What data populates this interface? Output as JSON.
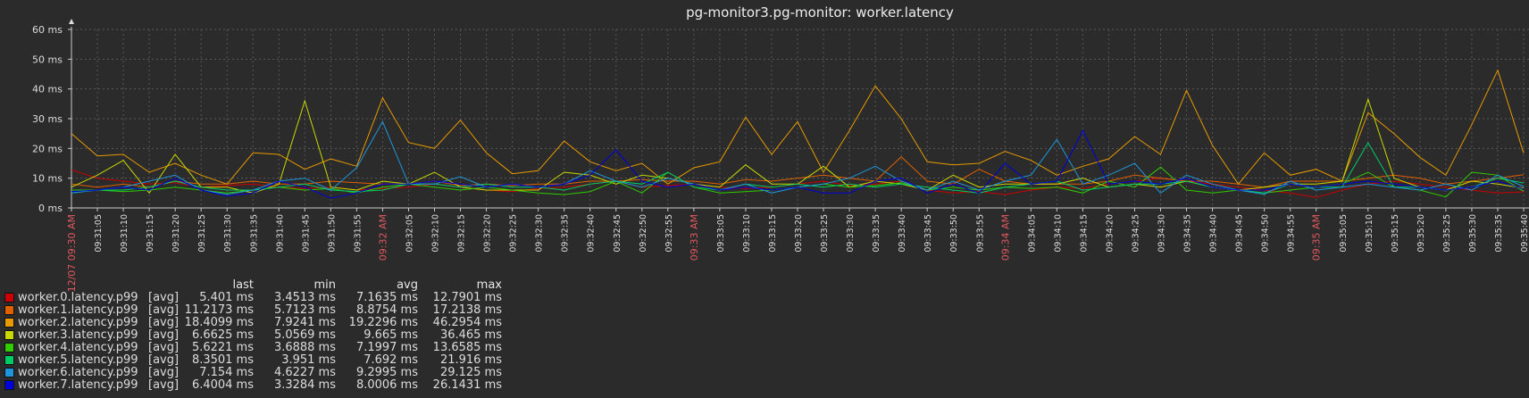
{
  "chart_data": {
    "type": "line",
    "title": "pg-monitor3.pg-monitor: worker.latency",
    "ylim": [
      0,
      60
    ],
    "y_ticks": [
      "0 ms",
      "10 ms",
      "20 ms",
      "30 ms",
      "40 ms",
      "50 ms",
      "60 ms"
    ],
    "y_tick_values": [
      0,
      10,
      20,
      30,
      40,
      50,
      60
    ],
    "grid": true,
    "legend_position": "bottom-left",
    "x_tick_labels": [
      "12/07 09:30 AM",
      "09:31:05",
      "09:31:10",
      "09:31:15",
      "09:31:20",
      "09:31:25",
      "09:31:30",
      "09:31:35",
      "09:31:40",
      "09:31:45",
      "09:31:50",
      "09:31:55",
      "09:32 AM",
      "09:32:05",
      "09:32:10",
      "09:32:15",
      "09:32:20",
      "09:32:25",
      "09:32:30",
      "09:32:35",
      "09:32:40",
      "09:32:45",
      "09:32:50",
      "09:32:55",
      "09:33 AM",
      "09:33:05",
      "09:33:10",
      "09:33:15",
      "09:33:20",
      "09:33:25",
      "09:33:30",
      "09:33:35",
      "09:33:40",
      "09:33:45",
      "09:33:50",
      "09:33:55",
      "09:34 AM",
      "09:34:05",
      "09:34:10",
      "09:34:15",
      "09:34:20",
      "09:34:25",
      "09:34:30",
      "09:34:35",
      "09:34:40",
      "09:34:45",
      "09:34:50",
      "09:34:55",
      "09:35 AM",
      "09:35:05",
      "09:35:10",
      "09:35:15",
      "09:35:20",
      "09:35:25",
      "09:35:30",
      "09:35:35",
      "09:35:40"
    ],
    "major_tick_color": "#e0595f",
    "minor_tick_color": "#e0e0e0",
    "legend_header": {
      "last": "last",
      "min": "min",
      "avg": "avg",
      "max": "max"
    },
    "series": [
      {
        "name": "worker.0.latency.p99",
        "agg": "[avg]",
        "last": "5.401 ms",
        "min": "3.4513 ms",
        "avg": "7.1635 ms",
        "max": "12.7901 ms",
        "color": "#cc0000",
        "values": [
          12.8,
          10,
          9,
          8,
          8.5,
          7,
          7.5,
          8,
          7,
          6.5,
          7,
          6,
          6.5,
          7,
          8,
          7,
          6,
          5.5,
          6.5,
          7,
          8,
          9,
          7,
          7.5,
          8,
          7,
          6.5,
          7,
          8,
          9,
          7.5,
          8,
          9,
          6,
          5,
          5.5,
          4.5,
          6,
          7,
          6.5,
          8,
          9,
          10,
          9,
          8,
          7,
          6,
          5,
          3.5,
          6,
          8,
          9,
          8,
          7,
          6,
          5,
          5.4
        ]
      },
      {
        "name": "worker.1.latency.p99",
        "agg": "[avg]",
        "last": "11.2173 ms",
        "min": "5.7123 ms",
        "avg": "8.8754 ms",
        "max": "17.2138 ms",
        "color": "#e06000",
        "values": [
          8,
          7,
          8,
          7,
          9,
          8,
          8,
          9,
          8,
          8,
          9,
          8.5,
          8,
          8,
          9,
          7.5,
          8,
          7.5,
          8,
          8,
          9,
          9,
          9.5,
          9,
          9,
          8,
          9.5,
          9,
          10,
          11,
          10,
          9,
          17.2,
          9,
          8,
          13,
          9,
          8,
          8,
          8,
          9,
          11,
          10,
          9,
          9,
          8,
          7,
          9,
          9,
          9,
          10,
          11,
          10,
          8,
          9,
          10,
          11.2
        ]
      },
      {
        "name": "worker.2.latency.p99",
        "agg": "[avg]",
        "last": "18.4099 ms",
        "min": "7.9241 ms",
        "avg": "19.2296 ms",
        "max": "46.2954 ms",
        "color": "#e69a00",
        "values": [
          25,
          17.5,
          18,
          12,
          15,
          11,
          8,
          18.5,
          18,
          13,
          16.5,
          14,
          37,
          22,
          20,
          29.5,
          18.5,
          11.5,
          12.5,
          22.5,
          15.5,
          12.5,
          15,
          8,
          13.5,
          15.5,
          30.5,
          18,
          29,
          12,
          26,
          41,
          30,
          15.5,
          14.5,
          15,
          19,
          16,
          11,
          14,
          16.5,
          24,
          18,
          39.5,
          21,
          8,
          18.5,
          11,
          13,
          9,
          32,
          25,
          17,
          11,
          28,
          46.3,
          18.4
        ]
      },
      {
        "name": "worker.3.latency.p99",
        "agg": "[avg]",
        "last": "6.6625 ms",
        "min": "5.0569 ms",
        "avg": "9.665 ms",
        "max": "36.465 ms",
        "color": "#c8d800",
        "values": [
          7,
          11,
          16,
          5,
          18,
          7,
          7,
          5,
          8,
          36,
          7,
          6,
          9,
          8,
          12,
          7,
          6,
          6,
          6,
          12,
          11,
          8,
          11,
          10,
          8,
          7,
          14.5,
          8,
          8,
          14,
          7,
          9,
          8,
          6,
          11,
          7,
          8,
          8,
          8,
          10,
          7,
          8,
          7,
          9,
          7,
          6,
          7,
          8,
          8,
          9,
          36.5,
          10,
          7,
          6,
          9,
          8,
          6.7
        ]
      },
      {
        "name": "worker.4.latency.p99",
        "agg": "[avg]",
        "last": "5.6221 ms",
        "min": "3.6888 ms",
        "avg": "7.1997 ms",
        "max": "13.6585 ms",
        "color": "#2ecc00",
        "values": [
          6,
          6,
          5.5,
          6,
          7,
          6,
          5,
          6,
          7,
          6,
          6.5,
          5,
          7,
          8,
          7,
          6,
          7,
          6,
          5,
          4.5,
          5.5,
          9,
          5,
          12,
          7,
          5,
          5.5,
          6,
          7,
          8,
          7,
          7.5,
          8.5,
          6,
          7,
          6,
          7,
          6.5,
          7,
          5,
          9,
          7,
          13.7,
          6,
          5,
          6,
          5,
          6,
          7,
          8,
          12,
          7,
          6,
          3.7,
          12,
          11,
          5.6
        ]
      },
      {
        "name": "worker.5.latency.p99",
        "agg": "[avg]",
        "last": "8.3501 ms",
        "min": "3.951 ms",
        "avg": "7.692 ms",
        "max": "21.916 ms",
        "color": "#00cc66",
        "values": [
          5,
          6,
          6,
          7,
          9,
          7,
          6,
          6,
          7,
          8,
          6,
          5.5,
          6,
          8,
          8,
          7,
          8,
          7,
          7,
          6,
          8,
          9,
          8,
          12,
          7,
          6,
          8,
          7,
          8,
          7,
          8,
          7,
          8,
          7,
          6,
          5,
          7,
          8,
          9,
          6,
          7,
          8,
          8,
          9,
          7,
          6,
          5,
          8,
          7,
          7,
          21.9,
          7,
          7,
          6,
          7,
          10,
          8.4
        ]
      },
      {
        "name": "worker.6.latency.p99",
        "agg": "[avg]",
        "last": "7.154 ms",
        "min": "4.6227 ms",
        "avg": "9.2995 ms",
        "max": "29.125 ms",
        "color": "#1e96dc",
        "values": [
          5,
          6,
          7,
          9,
          11,
          6,
          4.6,
          6,
          9,
          10,
          6,
          13.5,
          29,
          8,
          8,
          10.5,
          7,
          8,
          7,
          8,
          12.5,
          9,
          7,
          10,
          8,
          6,
          8,
          5,
          7,
          8,
          10,
          14,
          9,
          6,
          9,
          6,
          9,
          11,
          23,
          8,
          11,
          15,
          5,
          11,
          8,
          6,
          4.6,
          9,
          6,
          7,
          8,
          7,
          6,
          8,
          6,
          11,
          7.2
        ]
      },
      {
        "name": "worker.7.latency.p99",
        "agg": "[avg]",
        "last": "6.4004 ms",
        "min": "3.3284 ms",
        "avg": "8.0006 ms",
        "max": "26.1431 ms",
        "color": "#0000dc",
        "values": [
          5.5,
          6,
          7,
          6,
          10,
          6,
          4,
          5,
          9,
          7,
          3.3,
          5,
          8,
          8,
          9,
          8,
          7,
          8,
          7,
          8,
          11,
          19.5,
          9,
          7,
          8,
          6,
          7,
          6,
          7,
          5,
          5,
          9,
          10,
          5,
          8,
          5,
          15,
          8,
          9,
          26,
          8,
          9,
          8,
          10,
          7,
          6,
          6,
          8,
          7,
          8,
          9,
          8,
          7,
          6,
          7,
          9,
          6.4
        ]
      }
    ]
  }
}
